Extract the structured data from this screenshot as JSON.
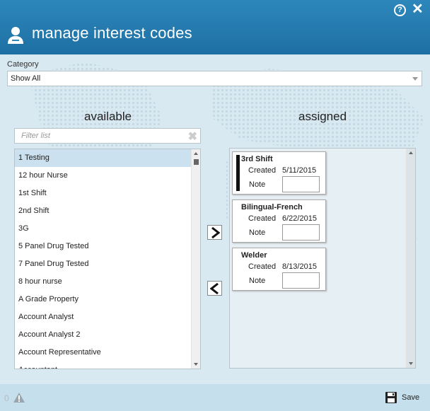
{
  "window": {
    "title": "manage interest codes",
    "help_icon": "help-circle-icon",
    "help_glyph": "?",
    "close_icon": "close-icon",
    "close_glyph": "✕"
  },
  "category": {
    "label": "Category",
    "selected": "Show All"
  },
  "available": {
    "heading": "available",
    "filter_placeholder": "Filter list",
    "items": [
      {
        "label": "1 Testing",
        "selected": true
      },
      {
        "label": "12 hour Nurse",
        "selected": false
      },
      {
        "label": "1st Shift",
        "selected": false
      },
      {
        "label": "2nd Shift",
        "selected": false
      },
      {
        "label": "3G",
        "selected": false
      },
      {
        "label": "5 Panel Drug Tested",
        "selected": false
      },
      {
        "label": "7 Panel Drug Tested",
        "selected": false
      },
      {
        "label": "8 hour nurse",
        "selected": false
      },
      {
        "label": "A Grade Property",
        "selected": false
      },
      {
        "label": "Account Analyst",
        "selected": false
      },
      {
        "label": "Account Analyst 2",
        "selected": false
      },
      {
        "label": "Account Representative",
        "selected": false
      },
      {
        "label": "Accountant",
        "selected": false
      }
    ]
  },
  "assigned": {
    "heading": "assigned",
    "created_label": "Created",
    "note_label": "Note",
    "items": [
      {
        "name": "3rd Shift",
        "created": "5/11/2015",
        "has_color_bar": true,
        "bar_color": "#111111"
      },
      {
        "name": "Bilingual-French",
        "created": "6/22/2015",
        "has_color_bar": false
      },
      {
        "name": "Welder",
        "created": "8/13/2015",
        "has_color_bar": false
      }
    ]
  },
  "footer": {
    "count": "0",
    "warning_icon": "warning-icon",
    "save_label": "Save",
    "save_icon": "save-disk-icon"
  }
}
